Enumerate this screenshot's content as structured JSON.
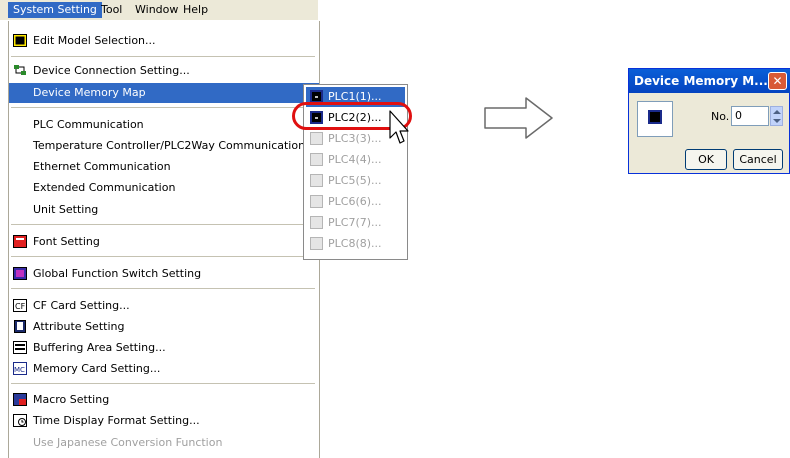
{
  "menubar": {
    "items": [
      {
        "label": "System Setting",
        "active": true
      },
      {
        "label": "Tool"
      },
      {
        "label": "Window"
      },
      {
        "label": "Help"
      }
    ]
  },
  "menu": {
    "items": [
      {
        "label": "Edit Model Selection...",
        "icon": "model-icon"
      },
      {
        "label": "Device Connection Setting...",
        "icon": "device-connection-icon"
      },
      {
        "label": "Device Memory Map",
        "highlighted": true,
        "submenu": true
      },
      {
        "label": "PLC Communication"
      },
      {
        "label": "Temperature Controller/PLC2Way Communication",
        "submenu": true
      },
      {
        "label": "Ethernet Communication",
        "submenu": true
      },
      {
        "label": "Extended Communication",
        "submenu": true
      },
      {
        "label": "Unit Setting",
        "submenu": true
      },
      {
        "label": "Font Setting",
        "icon": "font-icon"
      },
      {
        "label": "Global Function Switch Setting",
        "icon": "global-function-icon"
      },
      {
        "label": "CF Card Setting...",
        "icon": "cf-card-icon"
      },
      {
        "label": "Attribute Setting",
        "icon": "attribute-icon"
      },
      {
        "label": "Buffering Area Setting...",
        "icon": "buffering-icon"
      },
      {
        "label": "Memory Card Setting...",
        "icon": "memory-card-icon"
      },
      {
        "label": "Macro Setting",
        "icon": "macro-icon"
      },
      {
        "label": "Time Display Format Setting...",
        "icon": "time-display-icon"
      },
      {
        "label": "Use Japanese Conversion Function",
        "disabled": true
      }
    ]
  },
  "submenu": {
    "items": [
      {
        "label": "PLC1(1)...",
        "highlighted": true
      },
      {
        "label": "PLC2(2)..."
      },
      {
        "label": "PLC3(3)...",
        "disabled": true
      },
      {
        "label": "PLC4(4)...",
        "disabled": true
      },
      {
        "label": "PLC5(5)...",
        "disabled": true
      },
      {
        "label": "PLC6(6)...",
        "disabled": true
      },
      {
        "label": "PLC7(7)...",
        "disabled": true
      },
      {
        "label": "PLC8(8)...",
        "disabled": true
      }
    ]
  },
  "dialog": {
    "title": "Device Memory M...",
    "no_label": "No.",
    "no_value": "0",
    "ok_label": "OK",
    "cancel_label": "Cancel"
  },
  "colors": {
    "highlight": "#316ac5",
    "callout": "#e01010"
  }
}
